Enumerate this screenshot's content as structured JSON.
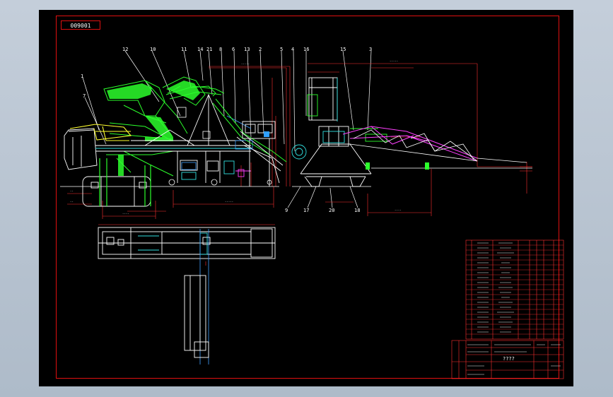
{
  "drawing": {
    "id": "009001",
    "callouts": [
      "12",
      "10",
      "11",
      "14",
      "21",
      "8",
      "6",
      "13",
      "2",
      "5",
      "4",
      "16",
      "15",
      "3",
      "1",
      "7",
      "9",
      "17",
      "20",
      "18"
    ],
    "title_block": {
      "title": "????"
    }
  },
  "colors": {
    "background": "#000000",
    "frame": "#e01010",
    "machine": "#2cff2c",
    "structure": "#ffffff",
    "dimensions": "#ff3030",
    "hidden": "#40a0ff",
    "accent": "#ffff30",
    "cyan": "#30e0e0",
    "magenta": "#ff40ff"
  }
}
